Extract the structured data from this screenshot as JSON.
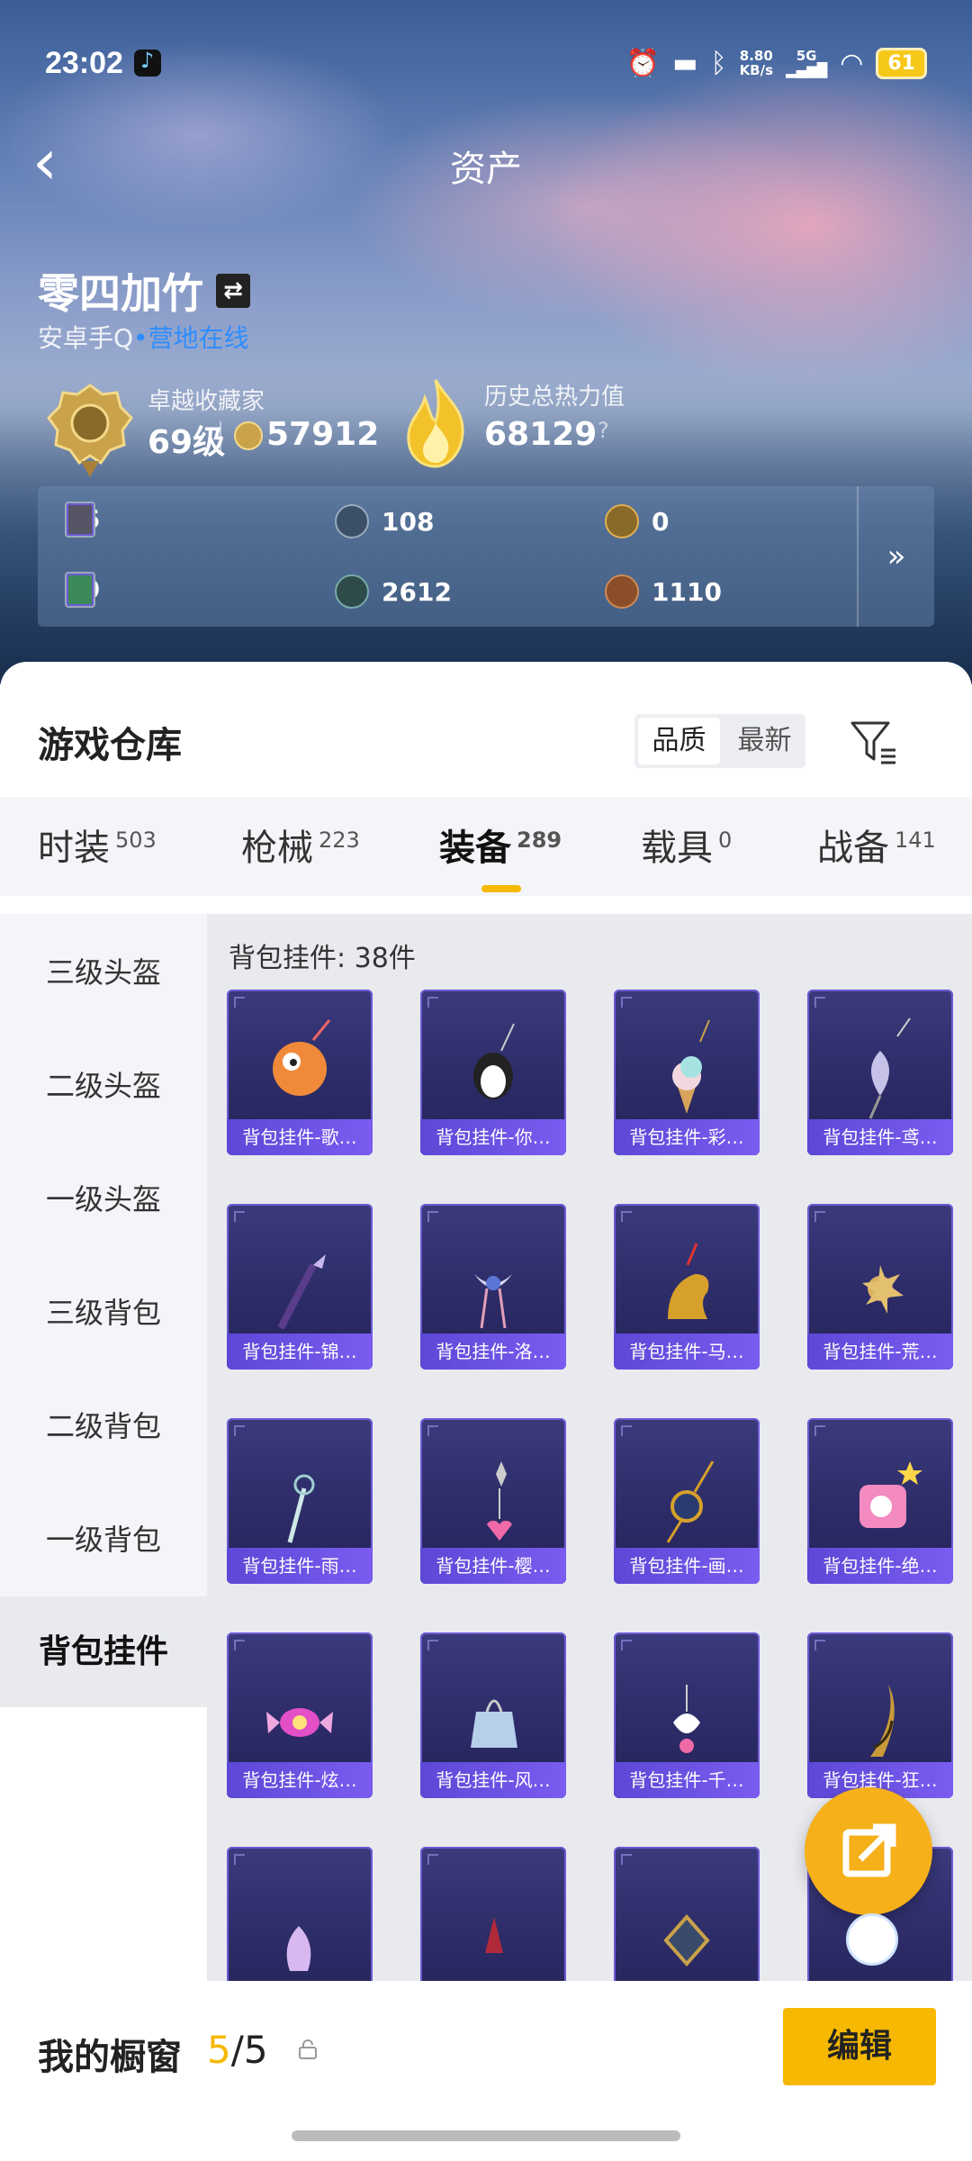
{
  "status_bar": {
    "time": "23:02",
    "speed_top": "8.80",
    "speed_bottom": "KB/s",
    "network": "5G",
    "battery": "61"
  },
  "header": {
    "title": "资产"
  },
  "profile": {
    "name": "零四加竹",
    "platform": "安卓手Q",
    "status_dot": "•",
    "status": "营地在线",
    "collector_label": "卓越收藏家",
    "level": "69级",
    "collector_points": "57912",
    "heat_label": "历史总热力值",
    "heat_value": "68129",
    "heat_help": "?"
  },
  "inventory": [
    {
      "icon": "purple-card-icon",
      "value": "66"
    },
    {
      "icon": "silver-coin-icon",
      "value": "108"
    },
    {
      "icon": "gold-coin-icon",
      "value": "0"
    },
    {
      "icon": "green-card-icon",
      "value": "30"
    },
    {
      "icon": "teal-coin-icon",
      "value": "2612"
    },
    {
      "icon": "copper-coin-icon",
      "value": "1110"
    }
  ],
  "inventory_more": "»",
  "warehouse": {
    "title": "游戏仓库",
    "sort": {
      "quality": "品质",
      "newest": "最新"
    },
    "tabs": [
      {
        "label": "时装",
        "count": "503"
      },
      {
        "label": "枪械",
        "count": "223"
      },
      {
        "label": "装备",
        "count": "289"
      },
      {
        "label": "载具",
        "count": "0"
      },
      {
        "label": "战备",
        "count": "141"
      }
    ],
    "sidebar": [
      "三级头盔",
      "二级头盔",
      "一级头盔",
      "三级背包",
      "二级背包",
      "一级背包",
      "背包挂件"
    ],
    "category_count": "背包挂件: 38件",
    "items": [
      "背包挂件-歌…",
      "背包挂件-你…",
      "背包挂件-彩…",
      "背包挂件-鸢…",
      "背包挂件-锦…",
      "背包挂件-洛…",
      "背包挂件-马…",
      "背包挂件-荒…",
      "背包挂件-雨…",
      "背包挂件-樱…",
      "背包挂件-画…",
      "背包挂件-绝…",
      "背包挂件-炫…",
      "背包挂件-风…",
      "背包挂件-千…",
      "背包挂件-狂…"
    ]
  },
  "footer": {
    "label": "我的橱窗",
    "used": "5",
    "sep": "/",
    "total": "5",
    "edit": "编辑"
  },
  "colors": {
    "accent": "#f6b800",
    "card_label": "#6a52e0",
    "online": "#2e8dff"
  }
}
